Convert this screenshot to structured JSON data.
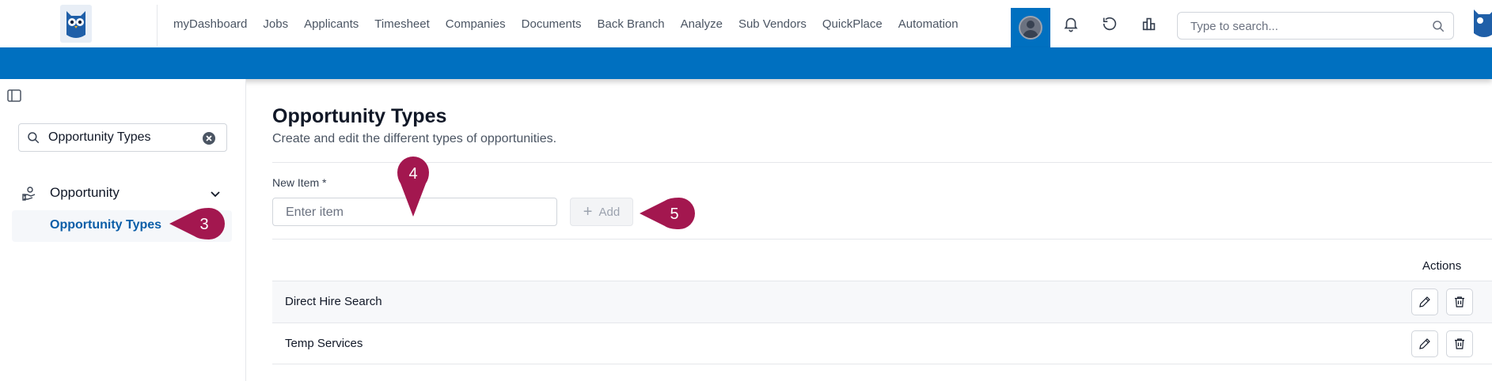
{
  "nav": {
    "items": [
      "myDashboard",
      "Jobs",
      "Applicants",
      "Timesheet",
      "Companies",
      "Documents",
      "Back Branch",
      "Analyze",
      "Sub Vendors",
      "QuickPlace",
      "Automation"
    ]
  },
  "topbar": {
    "search_placeholder": "Type to search..."
  },
  "sidebar": {
    "search_value": "Opportunity Types",
    "group_label": "Opportunity",
    "active_item": "Opportunity Types"
  },
  "main": {
    "title": "Opportunity Types",
    "subtitle": "Create and edit the different types of opportunities.",
    "field_label": "New Item *",
    "field_placeholder": "Enter item",
    "add_label": "Add",
    "actions_header": "Actions",
    "rows": [
      {
        "name": "Direct Hire Search"
      },
      {
        "name": "Temp Services"
      }
    ]
  },
  "callouts": [
    "3",
    "4",
    "5"
  ],
  "colors": {
    "brand_blue": "#0070c0",
    "callout": "#a3174f",
    "active_link": "#0b5ea8"
  }
}
